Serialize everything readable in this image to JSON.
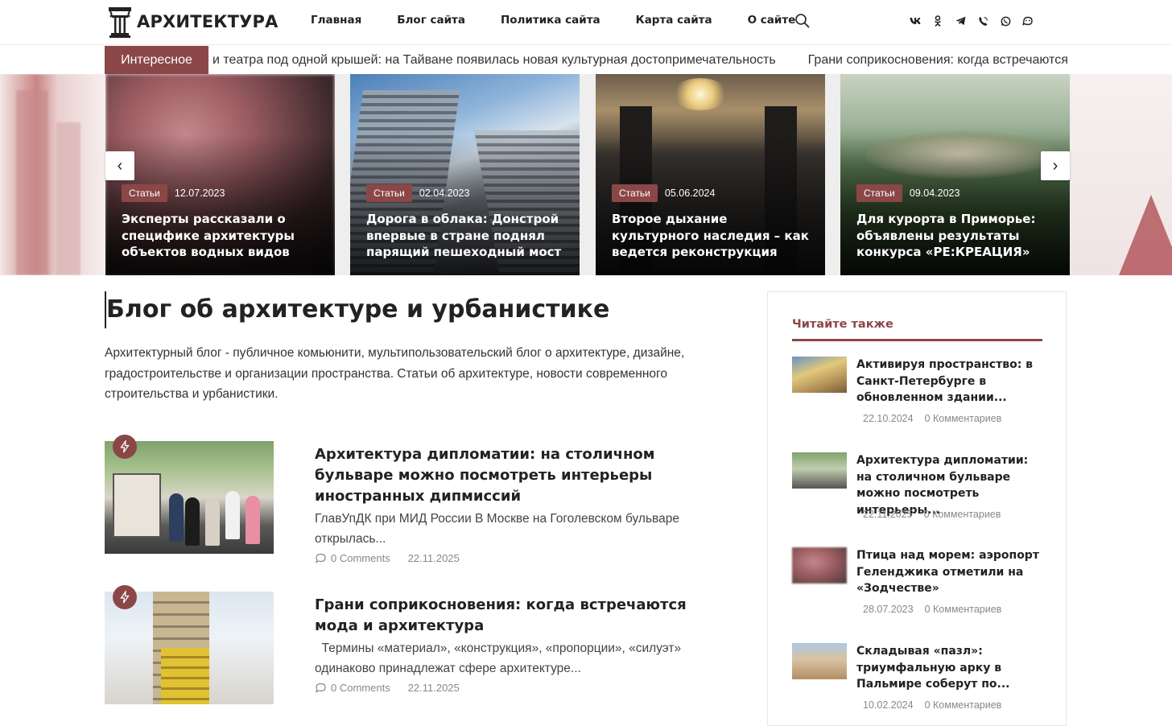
{
  "site": {
    "logo_text": "АРХИТЕКТУРА"
  },
  "nav": {
    "items": [
      "Главная",
      "Блог сайта",
      "Политика сайта",
      "Карта сайта",
      "О сайте"
    ]
  },
  "icons": {
    "search": "search-icon",
    "socials": [
      "vk-icon",
      "odnoklassniki-icon",
      "telegram-icon",
      "viber-icon",
      "whatsapp-icon",
      "max-icon"
    ]
  },
  "ticker": {
    "label": "Интересное",
    "items": [
      "и театра под одной крышей: на Тайване появилась новая культурная достопримечательность",
      "Грани соприкосновения: когда встречаются мода и архитектура"
    ]
  },
  "slider": {
    "prev_label": "‹",
    "next_label": "›",
    "slides": [
      {
        "category": "Статьи",
        "date": "12.07.2023",
        "title": "Эксперты рассказали о специфике архитектуры объектов водных видов спорта"
      },
      {
        "category": "Статьи",
        "date": "02.04.2023",
        "title": "Дорога в облака: Донстрой впервые в стране поднял парящий пешеходный мост"
      },
      {
        "category": "Статьи",
        "date": "05.06.2024",
        "title": "Второе дыхание культурного наследия – как ведется реконструкция исторических"
      },
      {
        "category": "Статьи",
        "date": "09.04.2023",
        "title": "Для курорта в Приморье: объявлены результаты конкурса «РЕ:КРЕАЦИЯ»"
      }
    ]
  },
  "main": {
    "title": "Блог об архитектуре и урбанистике",
    "intro": "Архитектурный блог - публичное комьюнити, мультипользовательский блог о архитектуре, дизайне, градостроительстве и организации пространства. Статьи об архитектуре, новости современного строительства и урбанистики.",
    "posts": [
      {
        "title": "Архитектура дипломатии: на столичном бульваре можно посмотреть интерьеры иностранных дипмиссий",
        "excerpt": "ГлавУпДК при МИД России В Москве на Гоголевском бульваре открылась...",
        "comments": "0 Comments",
        "date": "22.11.2025"
      },
      {
        "title": "Грани соприкосновения: когда встречаются мода и архитектура",
        "excerpt": "  Термины «материал», «конструкция», «пропорции», «силуэт» одинаково принадлежат сфере архитектуре...",
        "comments": "0 Comments",
        "date": "22.11.2025"
      }
    ]
  },
  "sidebar": {
    "heading": "Читайте также",
    "items": [
      {
        "title": "Активируя пространство: в Санкт-Петербурге в обновленном здании...",
        "date": "22.10.2024",
        "comments": "0 Комментариев"
      },
      {
        "title": "Архитектура дипломатии: на столичном бульваре можно посмотреть интерьеры...",
        "date": "22.11.2025",
        "comments": "0 Комментариев"
      },
      {
        "title": "Птица над морем: аэропорт Геленджика отметили на «Зодчестве»",
        "date": "28.07.2023",
        "comments": "0 Комментариев"
      },
      {
        "title": "Складывая «пазл»: триумфальную арку в Пальмире соберут по...",
        "date": "10.02.2024",
        "comments": "0 Комментариев"
      }
    ]
  },
  "colors": {
    "accent": "#8b4747",
    "text": "#222222",
    "muted": "#888888"
  }
}
